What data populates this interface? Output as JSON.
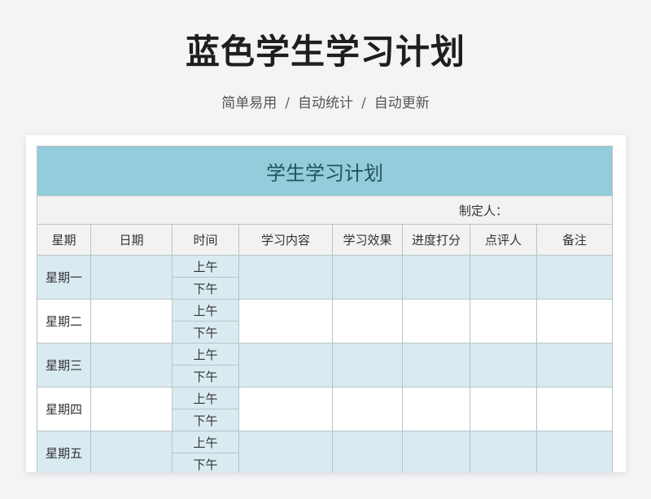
{
  "header": {
    "title": "蓝色学生学习计划",
    "tags": [
      "简单易用",
      "自动统计",
      "自动更新"
    ],
    "separator": "/"
  },
  "sheet": {
    "title": "学生学习计划",
    "maker_label": "制定人：",
    "columns": [
      "星期",
      "日期",
      "时间",
      "学习内容",
      "学习效果",
      "进度打分",
      "点评人",
      "备注"
    ],
    "slots": [
      "上午",
      "下午"
    ],
    "days": [
      "星期一",
      "星期二",
      "星期三",
      "星期四",
      "星期五"
    ]
  },
  "colors": {
    "title_band": "#93cddb",
    "row_tint": "#d9ebf1",
    "header_gray": "#f2f2f2",
    "grid_line": "#b9c3c9"
  }
}
